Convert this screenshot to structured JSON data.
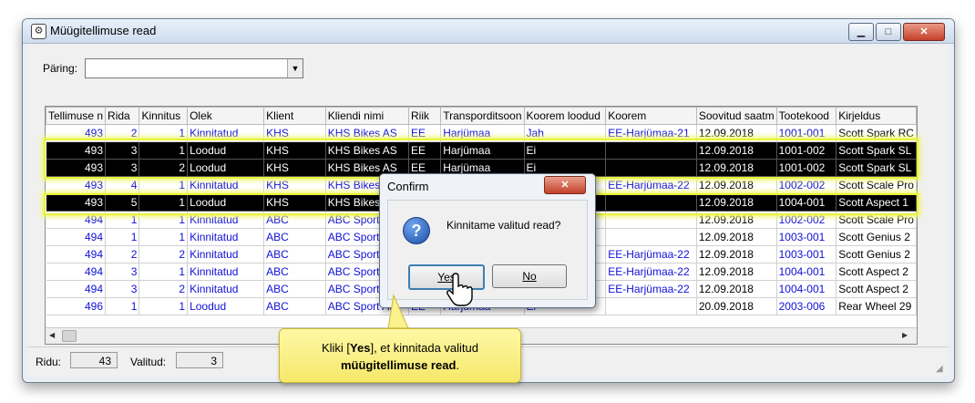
{
  "window": {
    "title": "Müügitellimuse read",
    "min_glyph": "▁",
    "max_glyph": "□",
    "close_glyph": "✕"
  },
  "query": {
    "label": "Päring:",
    "value": ""
  },
  "table": {
    "columns": [
      "Tellimuse n",
      "Rida",
      "Kinnitus",
      "Olek",
      "Klient",
      "Kliendi nimi",
      "Riik",
      "Transporditsoon",
      "Koorem loodud",
      "Koorem",
      "Soovitud saatm",
      "Tootekood",
      "Kirjeldus"
    ],
    "rows": [
      {
        "order": "493",
        "row": "2",
        "conf": "1",
        "status": "Kinnitatud",
        "client": "KHS",
        "name": "KHS Bikes AS",
        "country": "EE",
        "zone": "Harjümaa",
        "created": "Jah",
        "load": "EE-Harjümaa-21",
        "date": "12.09.2018",
        "code": "1001-001",
        "desc": "Scott Spark RC"
      },
      {
        "order": "493",
        "row": "3",
        "conf": "1",
        "status": "Loodud",
        "client": "KHS",
        "name": "KHS Bikes AS",
        "country": "EE",
        "zone": "Harjümaa",
        "created": "Ei",
        "load": "",
        "date": "12.09.2018",
        "code": "1001-002",
        "desc": "Scott Spark SL"
      },
      {
        "order": "493",
        "row": "3",
        "conf": "2",
        "status": "Loodud",
        "client": "KHS",
        "name": "KHS Bikes AS",
        "country": "EE",
        "zone": "Harjümaa",
        "created": "Ei",
        "load": "",
        "date": "12.09.2018",
        "code": "1001-002",
        "desc": "Scott Spark SL"
      },
      {
        "order": "493",
        "row": "4",
        "conf": "1",
        "status": "Kinnitatud",
        "client": "KHS",
        "name": "KHS Bikes AS",
        "country": "EE",
        "zone": "Harjümaa",
        "created": "Jah",
        "load": "EE-Harjümaa-22",
        "date": "12.09.2018",
        "code": "1002-002",
        "desc": "Scott Scale Pro"
      },
      {
        "order": "493",
        "row": "5",
        "conf": "1",
        "status": "Loodud",
        "client": "KHS",
        "name": "KHS Bikes AS",
        "country": "EE",
        "zone": "Harjümaa",
        "created": "Ei",
        "load": "",
        "date": "12.09.2018",
        "code": "1004-001",
        "desc": "Scott Aspect 1"
      },
      {
        "order": "494",
        "row": "1",
        "conf": "1",
        "status": "Kinnitatud",
        "client": "ABC",
        "name": "ABC Sport",
        "country": "EE",
        "zone": "Harjümaa",
        "created": "Ei",
        "load": "",
        "date": "12.09.2018",
        "code": "1002-002",
        "desc": "Scott Scale Pro"
      },
      {
        "order": "494",
        "row": "1",
        "conf": "1",
        "status": "Kinnitatud",
        "client": "ABC",
        "name": "ABC Sport",
        "country": "EE",
        "zone": "Harjümaa",
        "created": "Ei",
        "load": "",
        "date": "12.09.2018",
        "code": "1003-001",
        "desc": "Scott Genius 2"
      },
      {
        "order": "494",
        "row": "2",
        "conf": "2",
        "status": "Kinnitatud",
        "client": "ABC",
        "name": "ABC Sport",
        "country": "EE",
        "zone": "Harjümaa",
        "created": "Jah",
        "load": "EE-Harjümaa-22",
        "date": "12.09.2018",
        "code": "1003-001",
        "desc": "Scott Genius 2"
      },
      {
        "order": "494",
        "row": "3",
        "conf": "1",
        "status": "Kinnitatud",
        "client": "ABC",
        "name": "ABC Sport",
        "country": "EE",
        "zone": "Harjümaa",
        "created": "Jah",
        "load": "EE-Harjümaa-22",
        "date": "12.09.2018",
        "code": "1004-001",
        "desc": "Scott Aspect 2"
      },
      {
        "order": "494",
        "row": "3",
        "conf": "2",
        "status": "Kinnitatud",
        "client": "ABC",
        "name": "ABC Sport",
        "country": "EE",
        "zone": "Harjümaa",
        "created": "Jah",
        "load": "EE-Harjümaa-22",
        "date": "12.09.2018",
        "code": "1004-001",
        "desc": "Scott Aspect 2"
      },
      {
        "order": "496",
        "row": "1",
        "conf": "1",
        "status": "Loodud",
        "client": "ABC",
        "name": "ABC Sport AS",
        "country": "EE",
        "zone": "Harjümaa",
        "created": "Ei",
        "load": "",
        "date": "20.09.2018",
        "code": "2003-006",
        "desc": "Rear Wheel 29"
      }
    ],
    "selected_rows": [
      1,
      2,
      4
    ]
  },
  "status": {
    "rows_label": "Ridu:",
    "rows_value": "43",
    "selected_label": "Valitud:",
    "selected_value": "3"
  },
  "dialog": {
    "title": "Confirm",
    "close_glyph": "✕",
    "icon_glyph": "?",
    "message": "Kinnitame valitud read?",
    "yes_label": "Yes",
    "no_label": "No"
  },
  "callout": {
    "line1_a": "Kliki [",
    "line1_bold": "Yes",
    "line1_b": "], et kinnitada valitud",
    "line2_bold": "müügitellimuse read",
    "line2_end": "."
  },
  "colors": {
    "link_text": "#1010d8",
    "selection_bg": "#000000",
    "highlight": "#e7f33b",
    "callout_bg": "#f7ec7a"
  }
}
